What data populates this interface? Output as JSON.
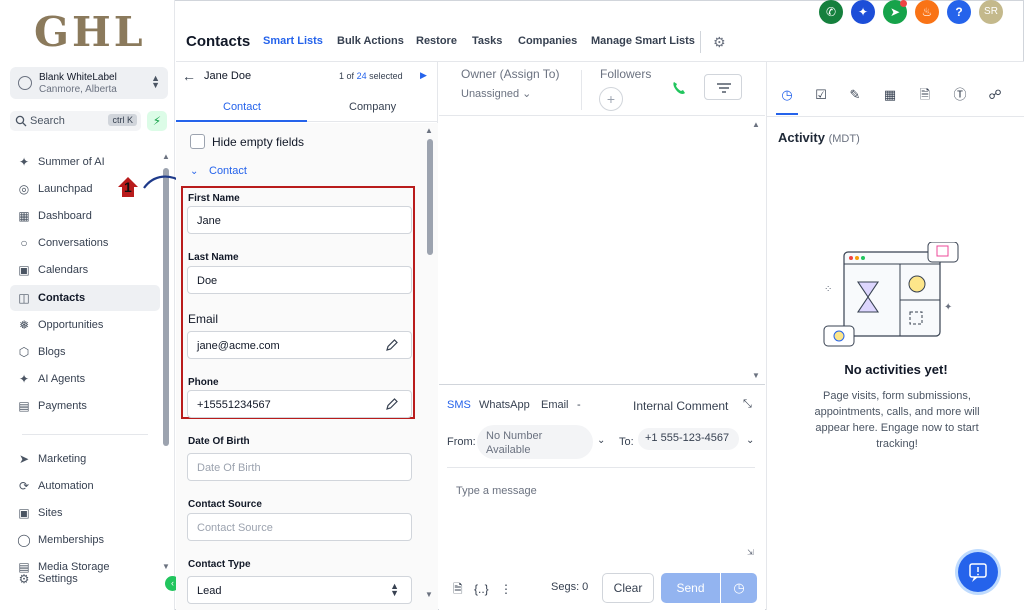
{
  "brand": {
    "logo_text": "GHL"
  },
  "account": {
    "name": "Blank WhiteLabel",
    "location": "Canmore, Alberta"
  },
  "search": {
    "label": "Search",
    "shortcut": "ctrl K"
  },
  "sidebar": {
    "items": [
      {
        "label": "Summer of AI",
        "icon": "sparkle-icon"
      },
      {
        "label": "Launchpad",
        "icon": "rocket-icon"
      },
      {
        "label": "Dashboard",
        "icon": "dashboard-icon"
      },
      {
        "label": "Conversations",
        "icon": "chat-icon"
      },
      {
        "label": "Calendars",
        "icon": "calendar-icon"
      },
      {
        "label": "Contacts",
        "icon": "contacts-icon",
        "active": true
      },
      {
        "label": "Opportunities",
        "icon": "opportunities-icon"
      },
      {
        "label": "Blogs",
        "icon": "blogs-icon"
      },
      {
        "label": "AI Agents",
        "icon": "ai-agents-icon"
      },
      {
        "label": "Payments",
        "icon": "payments-icon"
      }
    ],
    "items2": [
      {
        "label": "Marketing",
        "icon": "marketing-icon"
      },
      {
        "label": "Automation",
        "icon": "automation-icon"
      },
      {
        "label": "Sites",
        "icon": "sites-icon"
      },
      {
        "label": "Memberships",
        "icon": "memberships-icon"
      },
      {
        "label": "Media Storage",
        "icon": "media-icon"
      },
      {
        "label": "Settings",
        "icon": "settings-icon"
      }
    ]
  },
  "annotation": {
    "step": "1",
    "color": "#b91c1c"
  },
  "topbar": {
    "title": "Contacts",
    "tabs": [
      "Smart Lists",
      "Bulk Actions",
      "Restore",
      "Tasks",
      "Companies",
      "Manage Smart Lists"
    ],
    "active_tab": "Smart Lists",
    "user_initials": "SR",
    "header_icons": [
      {
        "icon": "phone-icon",
        "color": "#15803d"
      },
      {
        "icon": "sparkle-icon",
        "color": "#1d4ed8"
      },
      {
        "icon": "megaphone-icon",
        "color": "#16a34a"
      },
      {
        "icon": "bell-icon",
        "color": "#f97316"
      },
      {
        "icon": "help-icon",
        "color": "#2563eb"
      },
      {
        "icon": "avatar",
        "color": "#c4b98c"
      }
    ]
  },
  "contact_panel": {
    "name": "Jane Doe",
    "pager": {
      "current": "1",
      "of": "of",
      "total": "24",
      "suffix": "selected"
    },
    "tabs": [
      "Contact",
      "Company"
    ],
    "hide_empty": "Hide empty fields",
    "section": "Contact",
    "fields": {
      "first_name": {
        "label": "First Name",
        "value": "Jane"
      },
      "last_name": {
        "label": "Last Name",
        "value": "Doe"
      },
      "email": {
        "label": "Email",
        "value": "jane@acme.com"
      },
      "phone": {
        "label": "Phone",
        "value": "+15551234567"
      },
      "dob": {
        "label": "Date Of Birth",
        "placeholder": "Date Of Birth"
      },
      "source": {
        "label": "Contact Source",
        "placeholder": "Contact Source"
      },
      "type": {
        "label": "Contact Type",
        "value": "Lead"
      }
    }
  },
  "middle": {
    "owner_label": "Owner (Assign To)",
    "owner_value": "Unassigned",
    "followers_label": "Followers",
    "composer": {
      "tabs": [
        "SMS",
        "WhatsApp",
        "Email"
      ],
      "email_dash": "-",
      "internal": "Internal Comment",
      "from_label": "From:",
      "from_value": "No Number Available",
      "to_label": "To:",
      "to_value": "+1 555-123-4567",
      "placeholder": "Type a message",
      "segs": "Segs: 0",
      "clear": "Clear",
      "send": "Send"
    }
  },
  "activity": {
    "title": "Activity",
    "tz": "(MDT)",
    "empty_title": "No activities yet!",
    "empty_desc": "Page visits, form submissions, appointments, calls, and more will appear here. Engage now to start tracking!"
  },
  "colors": {
    "accent": "#2563eb",
    "highlight": "#b91c1c",
    "brand": "#8b7a5c"
  }
}
